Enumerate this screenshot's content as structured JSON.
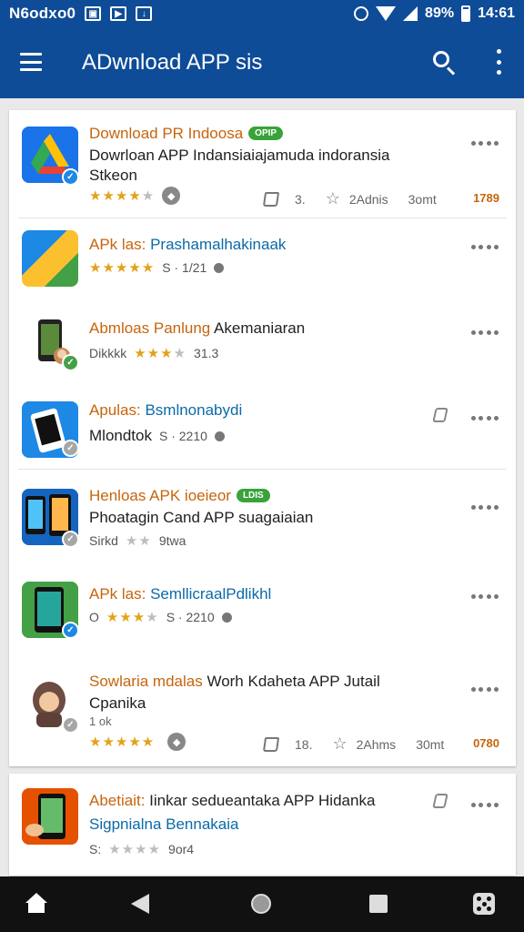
{
  "status_bar": {
    "carrier": "N6odxo0",
    "battery": "89%",
    "time": "14:61"
  },
  "app_bar": {
    "title": "ADwnload APP sis"
  },
  "items": [
    {
      "title_a": "Download PR Indoosa",
      "title_b": "",
      "pill": "OPIP",
      "desc1": "Dowrloan APP Indansiaiajamuda indoransia",
      "desc2": "Stkeon",
      "rating_text": "",
      "stats_count": "3.",
      "stats_label": "2Adnis",
      "stats_time": "3omt",
      "size": "1789"
    },
    {
      "title_a": "APk las: ",
      "title_b": "Prashamalhakinaak",
      "meta_text": "S · 1/21"
    },
    {
      "title_a": "Abmloas Panlung ",
      "title_b": "Akemaniaran",
      "meta_prefix": "Dikkkk",
      "meta_text": "31.3"
    },
    {
      "title_a": "Apulas: ",
      "title_b": "Bsmlnonabydi",
      "meta_prefix": "Mlondtok",
      "meta_text": "S · 2210"
    },
    {
      "title_a": "Henloas ",
      "title_b": "APK ioeieor",
      "pill": "LDIS",
      "desc1": "Phoatagin Cand APP suagaiaian",
      "meta_prefix": "Sirkd",
      "meta_text": "9twa"
    },
    {
      "title_a": "APk las: ",
      "title_b": "SemllicraalPdlikhl",
      "meta_prefix": "O",
      "meta_text": "S · 2210"
    },
    {
      "title_a": "Sowlaria mdalas ",
      "title_b": "Worh Kdaheta APP Jutail",
      "desc1": "Cpanika",
      "desc2": "1 ok",
      "stats_count": "18.",
      "stats_label": "2Ahms",
      "stats_time": "30mt",
      "size": "0780"
    },
    {
      "title_a": "Abetiait: ",
      "title_b": "Iinkar sedueantaka APP Hidanka",
      "desc1": "Sigpnialna Bennakaia",
      "meta_prefix": "S:",
      "meta_text": "9or4"
    }
  ],
  "colors": {
    "primary": "#0f4c97",
    "accent_orange": "#c6650c",
    "link_blue": "#0b6aa8",
    "star_gold": "#e3a21a",
    "pill_green": "#3aa23a"
  }
}
